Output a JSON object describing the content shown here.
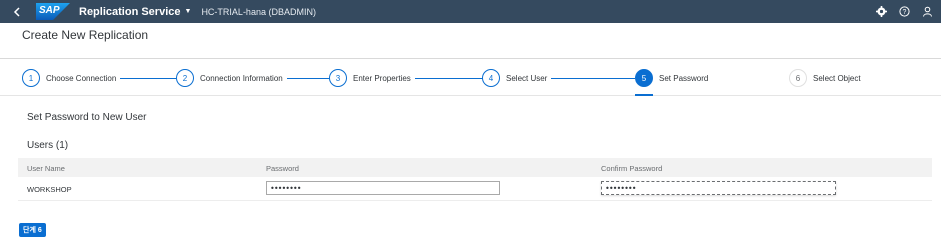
{
  "shell": {
    "app_title": "Replication Service",
    "subtitle": "HC-TRIAL-hana (DBADMIN)",
    "logo_text": "SAP"
  },
  "page": {
    "title": "Create New Replication"
  },
  "wizard": {
    "steps": [
      {
        "number": "1",
        "label": "Choose Connection"
      },
      {
        "number": "2",
        "label": "Connection Information"
      },
      {
        "number": "3",
        "label": "Enter Properties"
      },
      {
        "number": "4",
        "label": "Select User"
      },
      {
        "number": "5",
        "label": "Set Password"
      },
      {
        "number": "6",
        "label": "Select Object"
      }
    ]
  },
  "content": {
    "section_title": "Set Password to New User",
    "users_title": "Users (1)",
    "columns": [
      "User Name",
      "Password",
      "Confirm Password"
    ],
    "rows": [
      {
        "user_name": "WORKSHOP",
        "password": "••••••••",
        "confirm_password": "••••••••"
      }
    ]
  },
  "footer": {
    "step_button": "단계 6"
  },
  "colors": {
    "shell": "#354a5f",
    "accent": "#0a6ed1"
  }
}
